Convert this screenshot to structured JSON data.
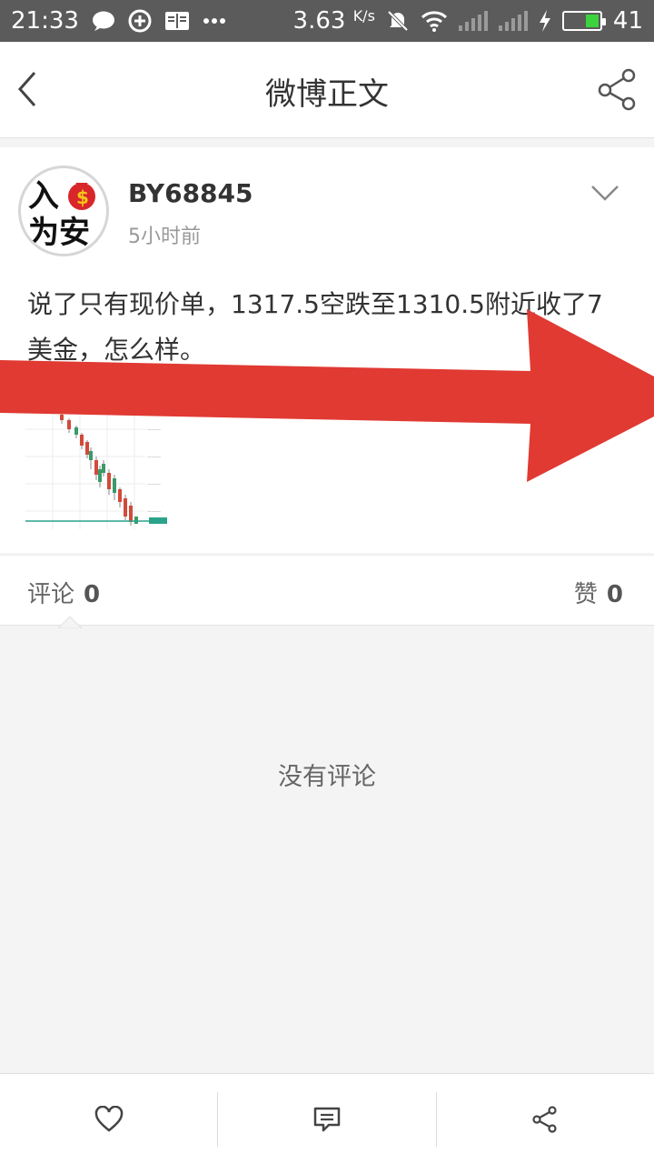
{
  "status_bar": {
    "time": "21:33",
    "net_speed": "3.63",
    "net_unit": "K/s",
    "battery": "41",
    "icons": [
      "chat-bubble-icon",
      "sync-icon",
      "reader-icon",
      "more-dots-icon",
      "mute-icon",
      "wifi-icon",
      "signal-icon",
      "signal-icon",
      "charging-icon",
      "battery-icon"
    ]
  },
  "header": {
    "title": "微博正文",
    "back_icon": "chevron-left-icon",
    "share_icon": "share-icon"
  },
  "post": {
    "avatar_text_line1": "入",
    "avatar_text_line2": "为安",
    "username": "BY68845",
    "time": "5小时前",
    "text": "说了只有现价单，1317.5空跌至1310.5附近收了7美金，怎么样。",
    "menu_icon": "chevron-down-icon",
    "image_icon": "candlestick-chart-image"
  },
  "counters": {
    "comments_label": "评论",
    "comments_count": "0",
    "likes_label": "赞",
    "likes_count": "0"
  },
  "empty_state": {
    "text": "没有评论"
  },
  "bottom_bar": {
    "like_icon": "heart-icon",
    "comment_icon": "comment-icon",
    "share_icon": "share-icon"
  },
  "colors": {
    "status_bar_bg": "#5b5b5b",
    "arrow_red": "#e03a33",
    "avatar_money_bag": "#d8262b",
    "battery_fill": "#3bd23d"
  }
}
